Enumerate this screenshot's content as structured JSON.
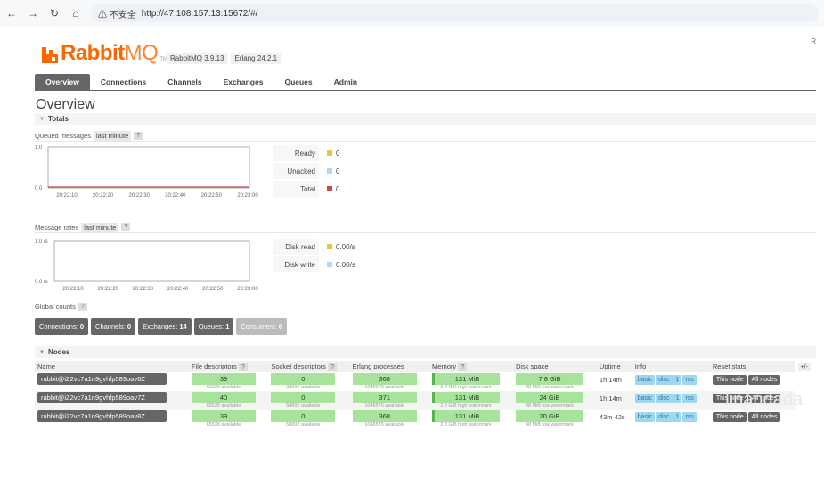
{
  "browser": {
    "warning": "⚠ 不安全",
    "url": "http://47.108.157.13:15672/#/"
  },
  "header": {
    "logo_rabbit": "Rabbit",
    "logo_mq": "MQ",
    "tm": "TM",
    "version_rabbit": "RabbitMQ 3.9.13",
    "version_erlang": "Erlang 24.2.1",
    "corner_letter": "R"
  },
  "tabs": [
    {
      "label": "Overview"
    },
    {
      "label": "Connections"
    },
    {
      "label": "Channels"
    },
    {
      "label": "Exchanges"
    },
    {
      "label": "Queues"
    },
    {
      "label": "Admin"
    }
  ],
  "page_title": "Overview",
  "totals": {
    "heading": "Totals"
  },
  "queued": {
    "label": "Queued messages",
    "range": "last minute",
    "help": "?",
    "y_top": "1.0",
    "y_bottom": "0.0",
    "x_ticks": [
      "20:22:10",
      "20:22:20",
      "20:22:30",
      "20:22:40",
      "20:22:50",
      "20:23:00"
    ],
    "legend": [
      {
        "label": "Ready",
        "value": "0",
        "color": "#edc240"
      },
      {
        "label": "Unacked",
        "value": "0",
        "color": "#afd8f8"
      },
      {
        "label": "Total",
        "value": "0",
        "color": "#cb4b4b"
      }
    ]
  },
  "rates": {
    "label": "Message rates",
    "range": "last minute",
    "help": "?",
    "y_top": "1.0 /s",
    "y_bottom": "0.0 /s",
    "x_ticks": [
      "20:22:10",
      "20:22:20",
      "20:22:30",
      "20:22:40",
      "20:22:50",
      "20:23:00"
    ],
    "legend": [
      {
        "label": "Disk read",
        "value": "0.00/s",
        "color": "#edc240"
      },
      {
        "label": "Disk write",
        "value": "0.00/s",
        "color": "#afd8f8"
      }
    ]
  },
  "global": {
    "label": "Global counts",
    "help": "?",
    "counts": [
      {
        "label": "Connections:",
        "value": "0"
      },
      {
        "label": "Channels:",
        "value": "0"
      },
      {
        "label": "Exchanges:",
        "value": "14"
      },
      {
        "label": "Queues:",
        "value": "1"
      },
      {
        "label": "Consumers:",
        "value": "0"
      }
    ]
  },
  "nodes": {
    "heading": "Nodes",
    "columns": [
      "Name",
      "File descriptors",
      "?",
      "Socket descriptors",
      "?",
      "Erlang processes",
      "Memory",
      "?",
      "Disk space",
      "Uptime",
      "Info",
      "Reset stats",
      "+/-"
    ],
    "rows": [
      {
        "name": "rabbit@iZ2vc7a1n9gvhfp589oav6Z",
        "fd": "39",
        "fd_sub": "65535 available",
        "sd": "0",
        "sd_sub": "58892 available",
        "ep": "368",
        "ep_sub": "1048576 available",
        "mem": "131 MiB",
        "mem_sub": "2.8 GiB high watermark",
        "disk": "7.8 GiB",
        "disk_sub": "48 MiB low watermark",
        "uptime": "1h 14m"
      },
      {
        "name": "rabbit@iZ2vc7a1n9gvhfp589oav7Z",
        "fd": "40",
        "fd_sub": "65535 available",
        "sd": "0",
        "sd_sub": "58892 available",
        "ep": "371",
        "ep_sub": "1048576 available",
        "mem": "131 MiB",
        "mem_sub": "2.8 GiB high watermark",
        "disk": "24 GiB",
        "disk_sub": "48 MiB low watermark",
        "uptime": "1h 14m"
      },
      {
        "name": "rabbit@iZ2vc7a1n9gvhfp589oav8Z",
        "fd": "39",
        "fd_sub": "65535 available",
        "sd": "0",
        "sd_sub": "58892 available",
        "ep": "368",
        "ep_sub": "1048576 available",
        "mem": "131 MiB",
        "mem_sub": "2.8 GiB high watermark",
        "disk": "20 GiB",
        "disk_sub": "48 MiB low watermark",
        "uptime": "43m 42s"
      }
    ],
    "info_tags": [
      "basic",
      "disc",
      "1",
      "rss"
    ],
    "reset_this": "This node",
    "reset_all": "All nodes"
  },
  "watermark": "linandada"
}
